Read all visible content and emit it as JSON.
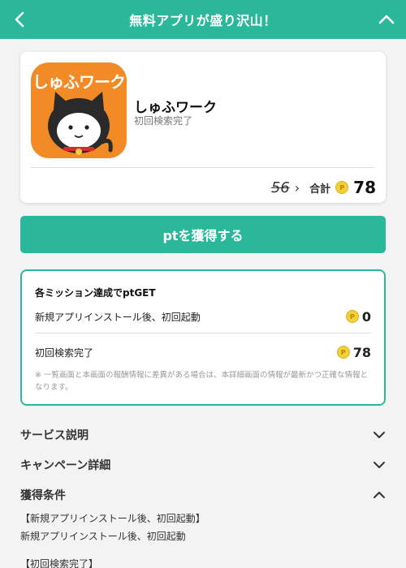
{
  "header": {
    "title": "無料アプリが盛り沢山！",
    "back_icon": "chevron-left-icon",
    "collapse_icon": "chevron-up-icon",
    "bg_color": "#2bb89a"
  },
  "app": {
    "icon_label": "しゅふワーク",
    "name": "しゅふワーク",
    "status": "初回検索完了",
    "old_points": "56",
    "total_label": "合計",
    "total_points": "78"
  },
  "get_button": {
    "label": "ptを獲得する"
  },
  "missions": {
    "title": "各ミッション達成でptGET",
    "items": [
      {
        "label": "新規アプリインストール後、初回起動",
        "points": "0"
      },
      {
        "label": "初回検索完了",
        "points": "78"
      }
    ],
    "note": "※ 一覧画面と本画面の報酬情報に差異がある場合は、本詳細画面の情報が最新かつ正確な情報となります。"
  },
  "accordion": {
    "service": "サービス説明",
    "campaign": "キャンペーン詳細",
    "conditions": "獲得条件"
  },
  "conditions": {
    "line1": "【新規アプリインストール後、初回起動】",
    "line2": "新規アプリインストール後、初回起動",
    "line3": "【初回検索完了】"
  },
  "coin_glyph": "P"
}
